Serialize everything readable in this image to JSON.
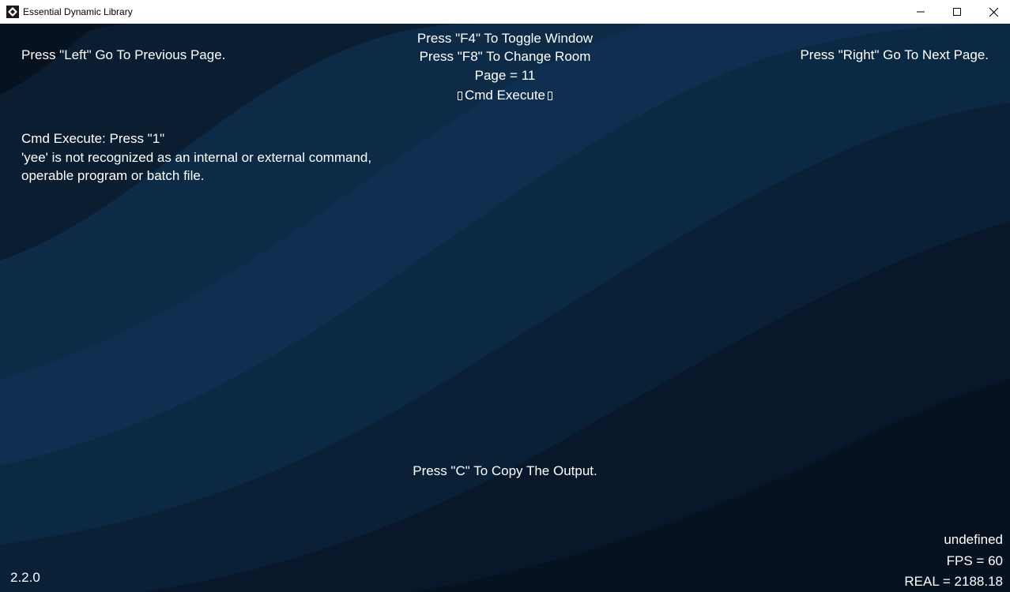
{
  "window": {
    "title": "Essential Dynamic Library",
    "controls": {
      "minimize": "minimize",
      "maximize": "maximize",
      "close": "close"
    }
  },
  "nav": {
    "left": "Press \"Left\" Go To Previous Page.",
    "right": "Press \"Right\" Go To Next Page."
  },
  "header": {
    "toggle_window": "Press \"F4\" To Toggle Window",
    "change_room": "Press \"F8\" To Change Room",
    "page": "Page = 11",
    "section": "Cmd Execute"
  },
  "output": {
    "prompt": "Cmd Execute: Press \"1\"",
    "line1": "'yee' is not recognized as an internal or external command,",
    "line2": "operable program or batch file."
  },
  "copy_hint": "Press \"C\" To Copy The Output.",
  "version": "2.2.0",
  "stats": {
    "status": "undefined",
    "fps": "FPS = 60",
    "real": "REAL = 2188.18"
  },
  "colors": {
    "background_dark": "#081321",
    "wave_mid": "#0c2740",
    "wave_light": "#0f3050",
    "text": "#ffffff"
  }
}
